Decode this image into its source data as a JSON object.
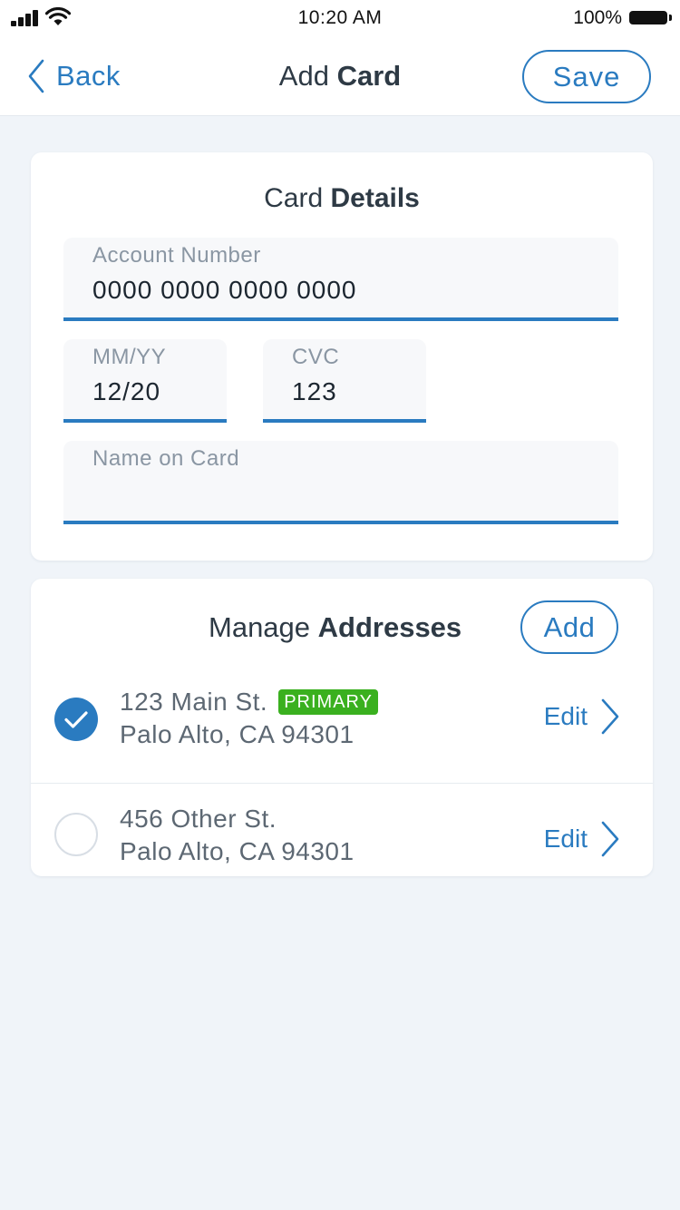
{
  "status_bar": {
    "time": "10:20 AM",
    "battery": "100%",
    "icons": [
      "signal-icon",
      "wifi-icon",
      "battery-icon"
    ]
  },
  "nav": {
    "back_label": "Back",
    "title_light": "Add ",
    "title_bold": "Card",
    "save_label": "Save"
  },
  "card_details": {
    "title_light": "Card ",
    "title_bold": "Details",
    "account_number": {
      "label": "Account Number",
      "value": "0000 0000 0000 0000"
    },
    "expiry": {
      "label": "MM/YY",
      "value": "12/20"
    },
    "cvc": {
      "label": "CVC",
      "value": "123"
    },
    "name_on_card": {
      "label": "Name on Card",
      "value": ""
    }
  },
  "addresses": {
    "title_light": "Manage ",
    "title_bold": "Addresses",
    "add_label": "Add",
    "items": [
      {
        "line1": "123 Main St.",
        "line2": "Palo Alto, CA 94301",
        "badge": "PRIMARY",
        "selected": true,
        "edit_label": "Edit"
      },
      {
        "line1": "456 Other St.",
        "line2": "Palo Alto, CA 94301",
        "selected": false,
        "edit_label": "Edit"
      }
    ]
  },
  "colors": {
    "accent": "#2a7bc0",
    "badge_green": "#3ab01f",
    "background": "#f0f4f9"
  }
}
